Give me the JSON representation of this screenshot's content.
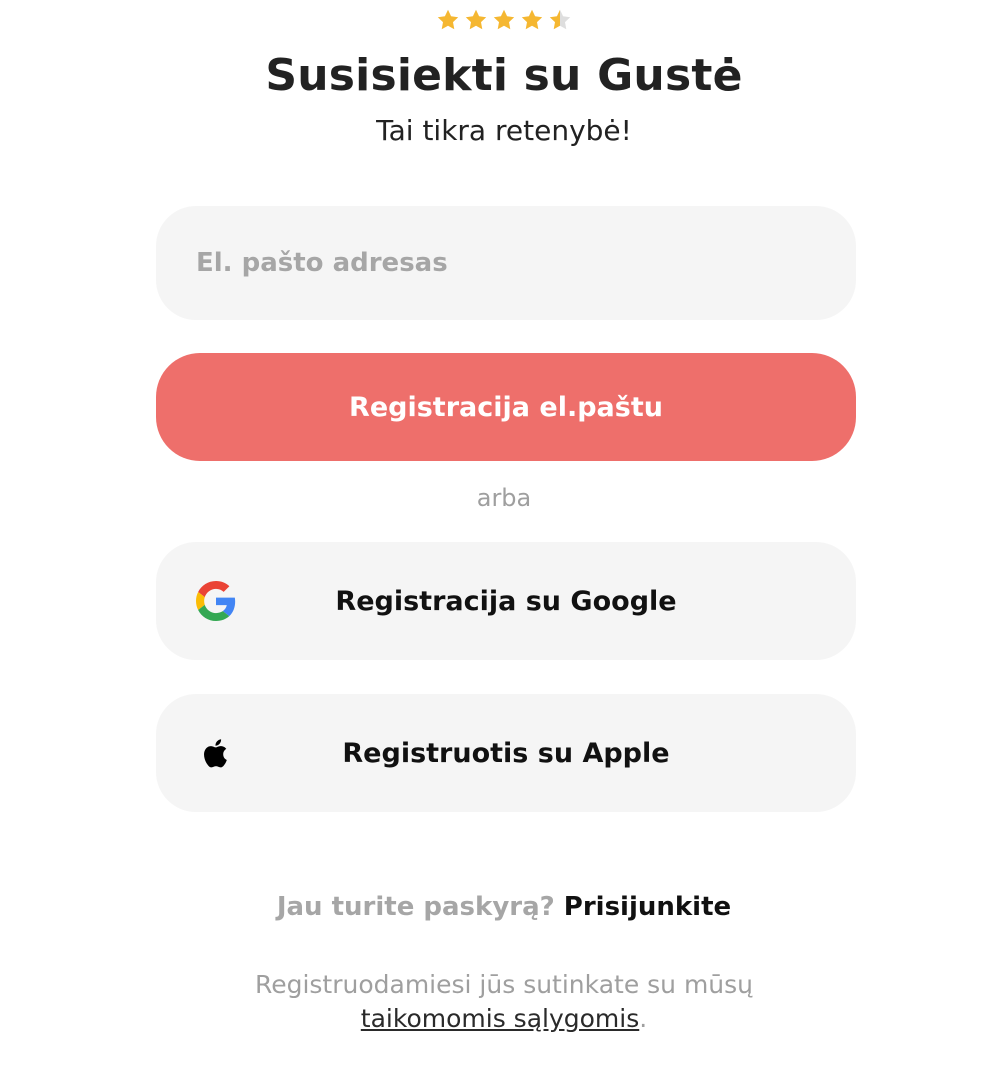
{
  "rating": {
    "value": 4.5,
    "max": 5,
    "star_color": "#f5b731",
    "empty_star_color": "#dedede"
  },
  "header": {
    "title": "Susisiekti su Gustė",
    "subtitle": "Tai tikra retenybė!"
  },
  "form": {
    "email_placeholder": "El. pašto adresas",
    "email_value": "",
    "register_email_label": "Registracija el.paštu",
    "accent_color": "#ee6f6b",
    "separator": "arba"
  },
  "social": {
    "google_label": "Registracija su Google",
    "google_icon": "google-icon",
    "apple_label": "Registruotis su Apple",
    "apple_icon": "apple-icon"
  },
  "footer": {
    "login_question": "Jau turite paskyrą?",
    "login_link": "Prisijunkite",
    "terms_text": "Registruodamiesi jūs sutinkate su mūsų",
    "terms_link": "taikomomis sąlygomis",
    "terms_end": "."
  }
}
